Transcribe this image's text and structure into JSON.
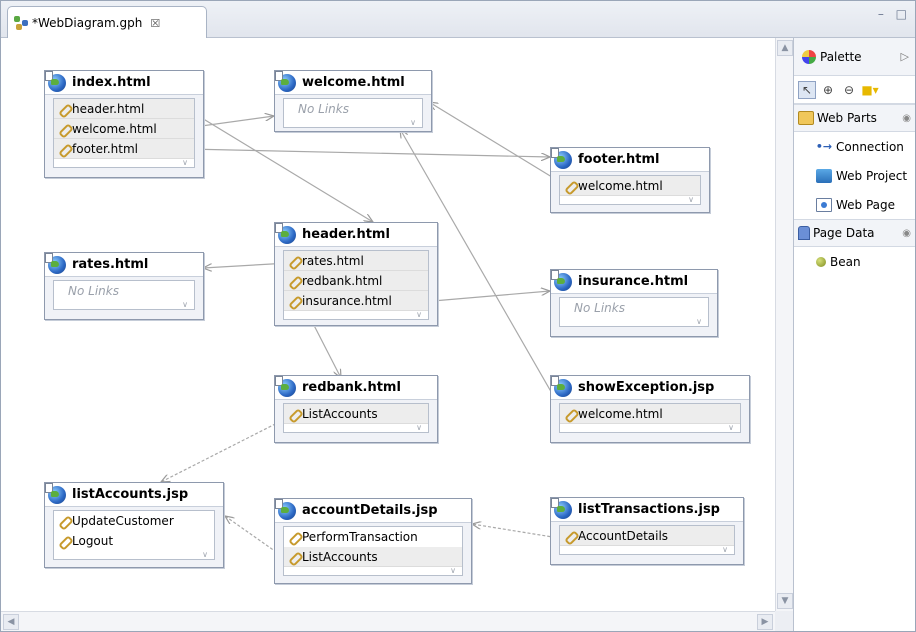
{
  "editor": {
    "tab_title": "*WebDiagram.gph",
    "close_glyph": "☒",
    "window_controls": "– □"
  },
  "nodes": [
    {
      "key": "index",
      "title": "index.html",
      "links": [
        "header.html",
        "welcome.html",
        "footer.html"
      ],
      "no_links": false
    },
    {
      "key": "welcome",
      "title": "welcome.html",
      "links": [],
      "no_links": true
    },
    {
      "key": "footer",
      "title": "footer.html",
      "links": [
        "welcome.html"
      ],
      "no_links": false
    },
    {
      "key": "header",
      "title": "header.html",
      "links": [
        "rates.html",
        "redbank.html",
        "insurance.html"
      ],
      "no_links": false
    },
    {
      "key": "rates",
      "title": "rates.html",
      "links": [],
      "no_links": true
    },
    {
      "key": "insurance",
      "title": "insurance.html",
      "links": [],
      "no_links": true
    },
    {
      "key": "redbank",
      "title": "redbank.html",
      "links": [
        "ListAccounts"
      ],
      "no_links": false
    },
    {
      "key": "showException",
      "title": "showException.jsp",
      "links": [
        "welcome.html"
      ],
      "no_links": false
    },
    {
      "key": "listAccounts",
      "title": "listAccounts.jsp",
      "links": [
        "UpdateCustomer",
        "Logout"
      ],
      "no_links": false
    },
    {
      "key": "accountDetails",
      "title": "accountDetails.jsp",
      "links": [
        "PerformTransaction",
        "ListAccounts"
      ],
      "no_links": false
    },
    {
      "key": "listTransactions",
      "title": "listTransactions.jsp",
      "links": [
        "AccountDetails"
      ],
      "no_links": false
    }
  ],
  "no_links_label": "No Links",
  "palette": {
    "title": "Palette",
    "tools": [
      "select-icon",
      "zoom-in-icon",
      "zoom-out-icon",
      "note-icon"
    ],
    "drawers": [
      {
        "title": "Web Parts",
        "icon": "folder-icon",
        "entries": [
          {
            "label": "Connection",
            "icon": "connection-icon"
          },
          {
            "label": "Web Project",
            "icon": "web-project-icon"
          },
          {
            "label": "Web Page",
            "icon": "web-page-icon"
          }
        ]
      },
      {
        "title": "Page Data",
        "icon": "page-data-icon",
        "entries": [
          {
            "label": "Bean",
            "icon": "bean-icon"
          }
        ]
      }
    ]
  },
  "colors": {
    "edge_solid": "#a9a9a9",
    "edge_dashed": "#a9a9a9",
    "node_border": "#8e99ad",
    "row_bg": "#ededed"
  }
}
